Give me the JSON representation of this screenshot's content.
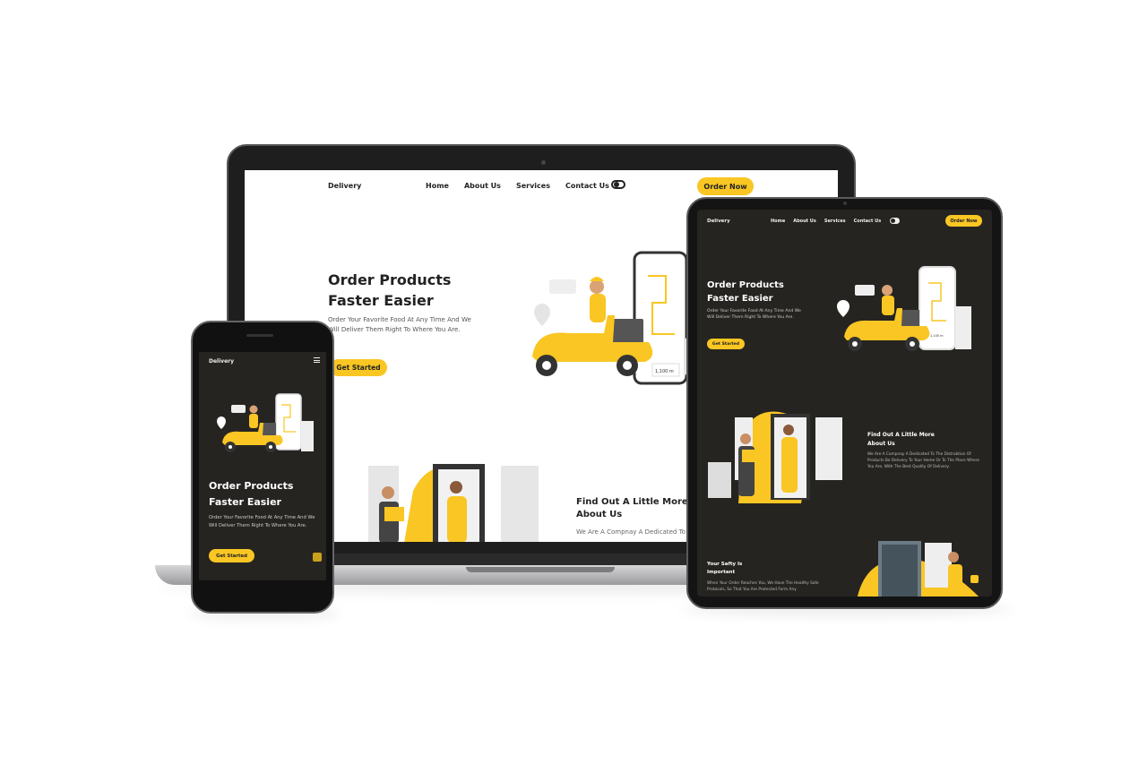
{
  "desktop": {
    "brand": "Delivery",
    "nav": [
      "Home",
      "About Us",
      "Services",
      "Contact Us"
    ],
    "order_button": "Order Now",
    "hero": {
      "title": "Order Products Faster Easier",
      "text": "Order Your Favorite Food At Any Time And We Will Deliver Them Right To Where You Are.",
      "button": "Get Started"
    },
    "about": {
      "title": "Find Out A Little More About Us",
      "text": "We Are A Compnay A Dedicated To"
    },
    "illustration_distance": "1,100 m"
  },
  "tablet": {
    "brand": "Delivery",
    "nav": [
      "Home",
      "About Us",
      "Services",
      "Contact Us"
    ],
    "order_button": "Order Now",
    "hero": {
      "title": "Order Products Faster Easier",
      "text": "Order Your Favorite Food At Any Time And We Will Deliver Them Right To Where You Are.",
      "button": "Get Started"
    },
    "about": {
      "title": "Find Out A Little More About Us",
      "text": "We Are A Compnay A Dedicated To The Distrubtion Of Products Be Delivery To Your Home Or To The Place Where You Are, With The Best Quality Of Delivery."
    },
    "safety": {
      "title": "Your Safty Is Important",
      "text": "When Your Order Reaches You, We Have The Healthy Safe Protocols, So That You Are Protected Form Any"
    },
    "illustration_distance": "1,100 m"
  },
  "phone": {
    "brand": "Delivery",
    "hero": {
      "title": "Order Products Faster Easier",
      "text": "Order Your Favorite Food At Any Time And We Will Deliver Them Right To Where You Are.",
      "button": "Get Started"
    }
  },
  "colors": {
    "accent": "#f9c623",
    "dark_bg": "#262421",
    "light_bg": "#ffffff",
    "text_dark": "#222222"
  },
  "icons": {
    "theme_toggle": "toggle-icon",
    "menu": "hamburger-menu-icon",
    "scroll_top": "arrow-up-icon",
    "location": "map-pin-icon"
  }
}
